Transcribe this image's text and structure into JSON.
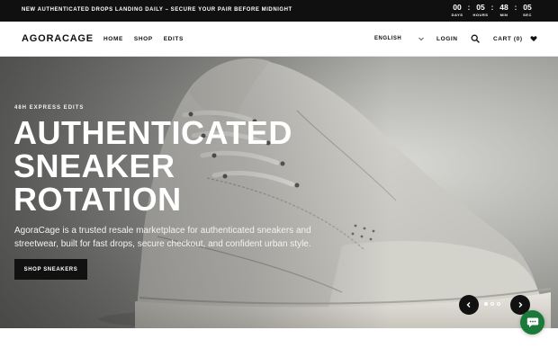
{
  "announcement": {
    "text": "NEW AUTHENTICATED DROPS LANDING DAILY – SECURE YOUR PAIR BEFORE MIDNIGHT",
    "countdown": [
      {
        "value": "00",
        "label": "DAYS"
      },
      {
        "value": "05",
        "label": "HOURS"
      },
      {
        "value": "48",
        "label": "MIN"
      },
      {
        "value": "05",
        "label": "SEC"
      }
    ],
    "separator": ":"
  },
  "header": {
    "logo": "AGORACAGE",
    "nav": [
      "HOME",
      "SHOP",
      "EDITS"
    ],
    "language": "ENGLISH",
    "login": "LOGIN",
    "cart": "CART (0)"
  },
  "hero": {
    "eyebrow": "48H EXPRESS EDITS",
    "headline": [
      "AUTHENTICATED",
      "SNEAKER",
      "ROTATION"
    ],
    "subcopy": "AgoraCage is a trusted resale marketplace for authenticated sneakers and streetwear, built for fast drops, secure checkout, and confident urban style.",
    "cta": "SHOP SNEAKERS",
    "slides": {
      "count": 3,
      "active": 0
    }
  },
  "icons": {
    "search": "search-icon",
    "cart_heart": "heart-icon",
    "language_chevron": "chevron-down-icon",
    "prev": "chevron-left-icon",
    "next": "chevron-right-icon",
    "chat": "chat-bubble-icon"
  },
  "colors": {
    "announcement_bg": "#101010",
    "cta_bg": "#111111",
    "chat_bg": "#1b7a3a"
  }
}
